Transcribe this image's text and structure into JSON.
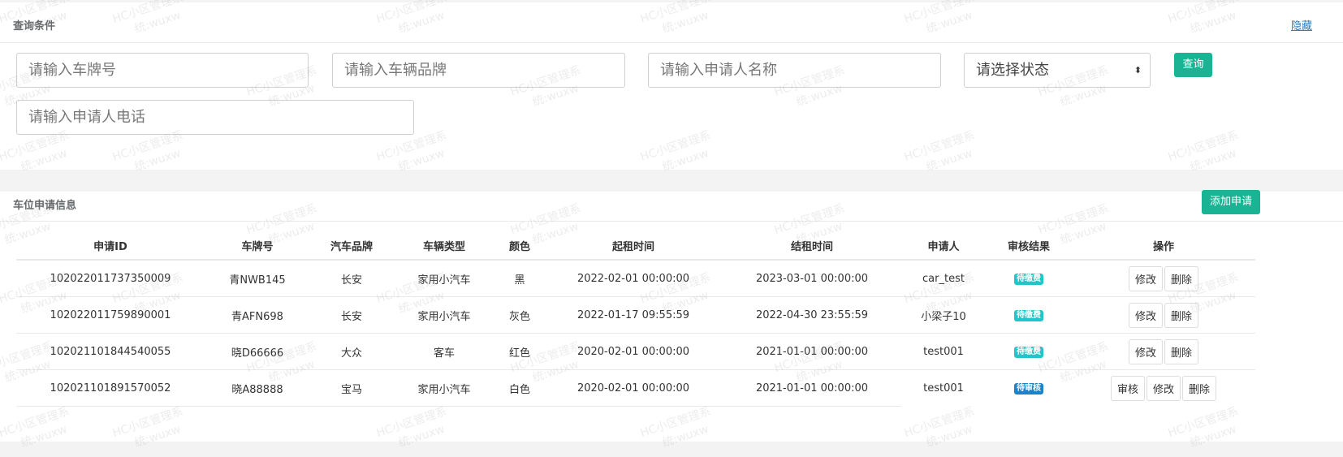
{
  "query": {
    "title": "查询条件",
    "hide_label": "隐藏",
    "plate_placeholder": "请输入车牌号",
    "brand_placeholder": "请输入车辆品牌",
    "applicant_placeholder": "请输入申请人名称",
    "status_placeholder": "请选择状态",
    "phone_placeholder": "请输入申请人电话",
    "search_label": "查询"
  },
  "list": {
    "title": "车位申请信息",
    "add_label": "添加申请",
    "headers": [
      "申请ID",
      "车牌号",
      "汽车品牌",
      "车辆类型",
      "颜色",
      "起租时间",
      "结租时间",
      "申请人",
      "审核结果",
      "操作"
    ],
    "rows": [
      {
        "id": "102022011737350009",
        "plate": "青NWB145",
        "brand": "长安",
        "type": "家用小汽车",
        "color": "黑",
        "start": "2022-02-01 00:00:00",
        "end": "2023-03-01 00:00:00",
        "applicant": "car_test",
        "status": "待缴费",
        "actions": [
          "修改",
          "删除"
        ]
      },
      {
        "id": "102022011759890001",
        "plate": "青AFN698",
        "brand": "长安",
        "type": "家用小汽车",
        "color": "灰色",
        "start": "2022-01-17 09:55:59",
        "end": "2022-04-30 23:55:59",
        "applicant": "小梁子10",
        "status": "待缴费",
        "actions": [
          "修改",
          "删除"
        ]
      },
      {
        "id": "102021101844540055",
        "plate": "晓D66666",
        "brand": "大众",
        "type": "客车",
        "color": "红色",
        "start": "2020-02-01 00:00:00",
        "end": "2021-01-01 00:00:00",
        "applicant": "test001",
        "status": "待缴费",
        "actions": [
          "修改",
          "删除"
        ]
      },
      {
        "id": "102021101891570052",
        "plate": "晓A88888",
        "brand": "宝马",
        "type": "家用小汽车",
        "color": "白色",
        "start": "2020-02-01 00:00:00",
        "end": "2021-01-01 00:00:00",
        "applicant": "test001",
        "status": "待审核",
        "actions": [
          "审核",
          "修改",
          "删除"
        ]
      }
    ]
  },
  "watermark": {
    "line1": "HC小区管理系",
    "line2": "统:wuxw"
  },
  "colors": {
    "accent": "#1ab394",
    "badge_pay": "#23c6c8",
    "badge_review": "#1c84c6",
    "link": "#337ab7"
  }
}
